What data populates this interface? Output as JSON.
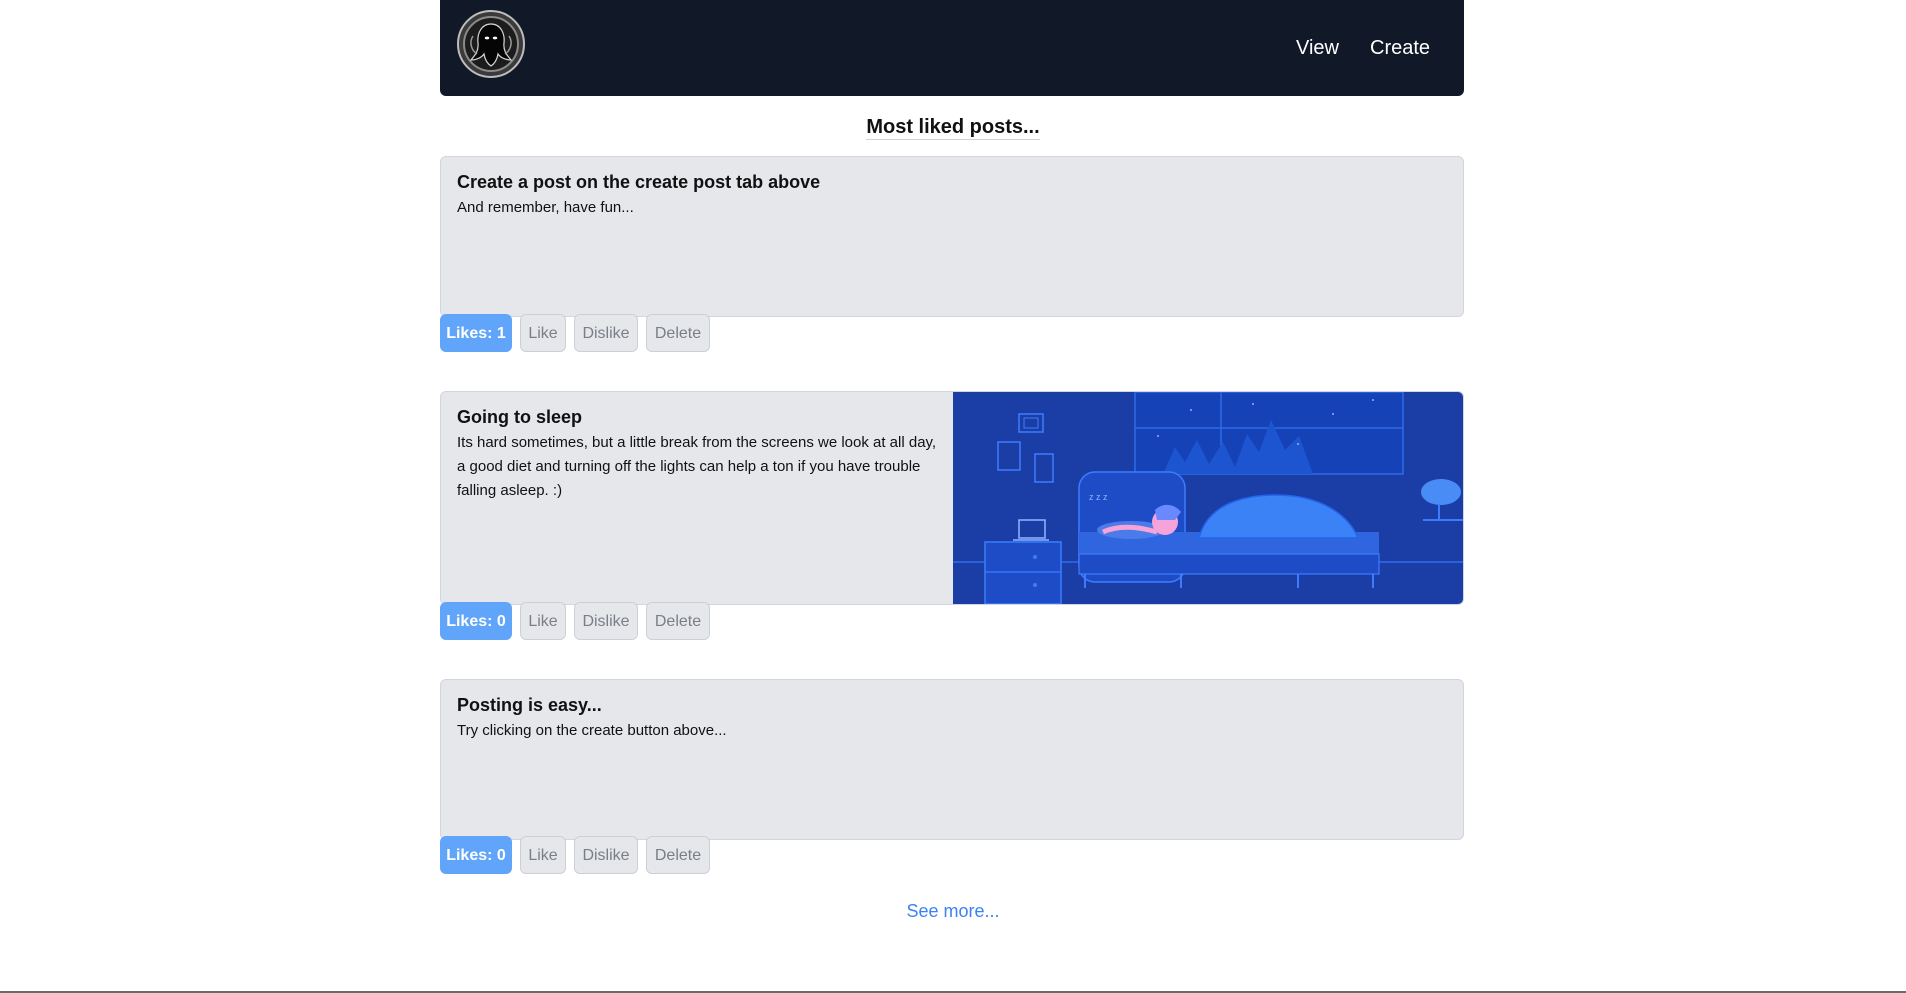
{
  "nav": {
    "logo_icon": "ghost-logo-icon",
    "links": [
      "View",
      "Create"
    ]
  },
  "section_title": "Most liked posts...",
  "posts": [
    {
      "title": "Create a post on the create post tab above",
      "body": "And remember, have fun...",
      "likes_label": "Likes: 1",
      "like": "Like",
      "dislike": "Dislike",
      "delete": "Delete"
    },
    {
      "title": "Going to sleep",
      "body": "Its hard sometimes, but a little break from the screens we look at all day, a good diet and turning off the lights can help a ton if you have trouble falling asleep. :)",
      "likes_label": "Likes: 0",
      "like": "Like",
      "dislike": "Dislike",
      "delete": "Delete",
      "image": "sleeping-person-illustration"
    },
    {
      "title": "Posting is easy...",
      "body": "Try clicking on the create button above...",
      "likes_label": "Likes: 0",
      "like": "Like",
      "dislike": "Dislike",
      "delete": "Delete"
    }
  ],
  "see_more": "See more...",
  "colors": {
    "navbar_bg": "#111827",
    "card_bg": "#e5e7eb",
    "likes_badge": "#60a5fa",
    "link": "#3b82f6",
    "illustration_bg": "#1b3ea6"
  }
}
